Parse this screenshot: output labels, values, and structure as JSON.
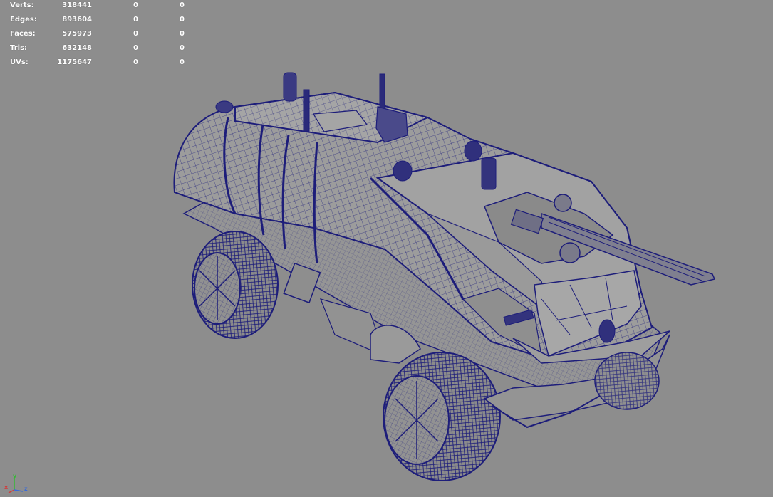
{
  "hud": {
    "rows": [
      {
        "label": "Verts:",
        "total": "318441",
        "selected": "0",
        "extra": "0"
      },
      {
        "label": "Edges:",
        "total": "893604",
        "selected": "0",
        "extra": "0"
      },
      {
        "label": "Faces:",
        "total": "575973",
        "selected": "0",
        "extra": "0"
      },
      {
        "label": "Tris:",
        "total": "632148",
        "selected": "0",
        "extra": "0"
      },
      {
        "label": "UVs:",
        "total": "1175647",
        "selected": "0",
        "extra": "0"
      }
    ]
  },
  "axis": {
    "x": "x",
    "y": "y",
    "z": "z"
  },
  "colors": {
    "viewport_bg": "#8d8d8d",
    "wireframe": "#1d1d7a",
    "shaded_body": "#9a9a9a",
    "axis_x": "#d23b3b",
    "axis_y": "#33b833",
    "axis_z": "#3a6bd8"
  }
}
